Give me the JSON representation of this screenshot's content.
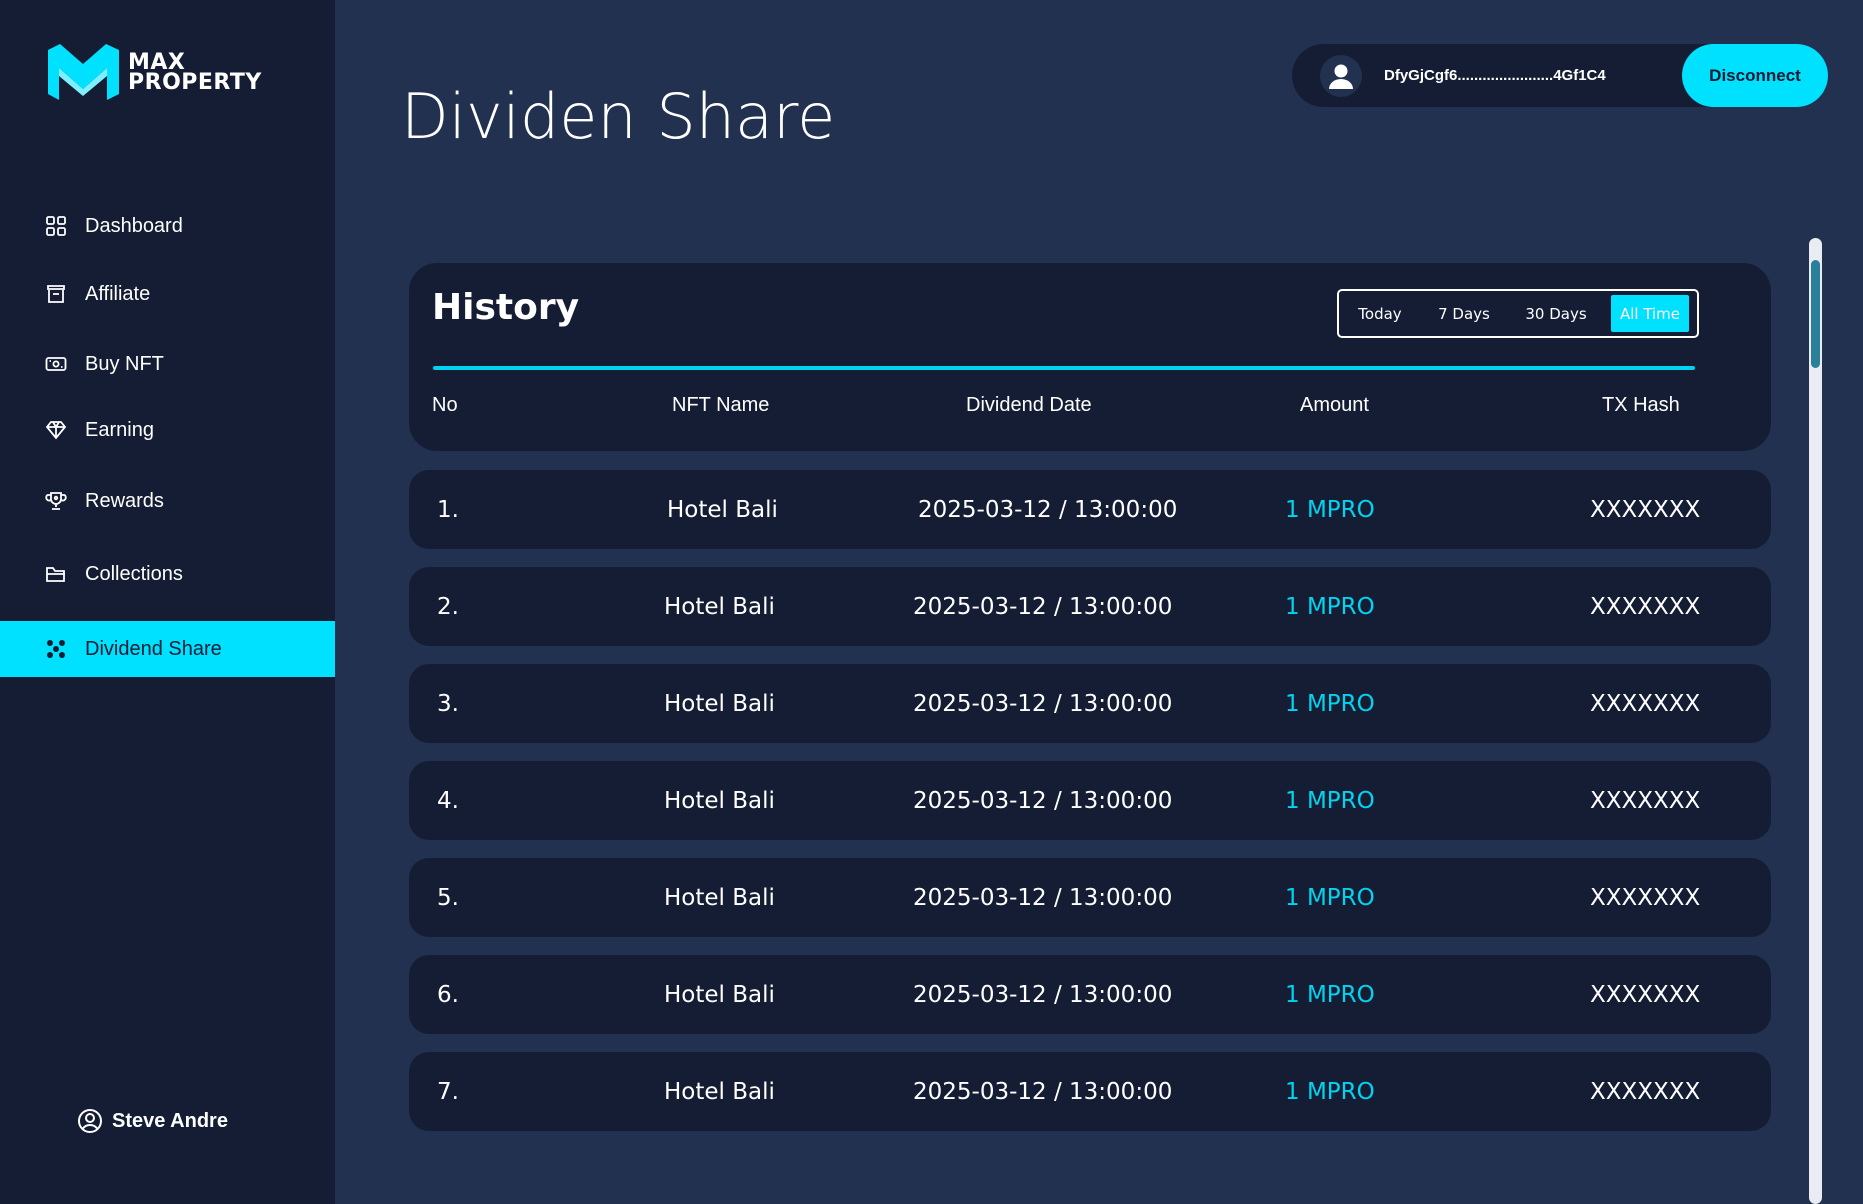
{
  "brand": {
    "line1": "MAX",
    "line2": "PROPERTY",
    "accent": "#00e0ff"
  },
  "sidebar": {
    "items": [
      {
        "label": "Dashboard",
        "icon": "grid-icon"
      },
      {
        "label": "Affiliate",
        "icon": "box-icon"
      },
      {
        "label": "Buy NFT",
        "icon": "cash-icon"
      },
      {
        "label": "Earning",
        "icon": "diamond-icon"
      },
      {
        "label": "Rewards",
        "icon": "trophy-icon"
      },
      {
        "label": "Collections",
        "icon": "folder-icon"
      },
      {
        "label": "Dividend Share",
        "icon": "nodes-icon",
        "active": true
      }
    ],
    "user": "Steve Andre"
  },
  "header": {
    "title": "Dividen Share",
    "wallet_address": "DfyGjCgf6.......................4Gf1C4",
    "disconnect_label": "Disconnect"
  },
  "history": {
    "title": "History",
    "filters": [
      "Today",
      "7 Days",
      "30 Days",
      "All Time"
    ],
    "active_filter": "All Time",
    "columns": [
      "No",
      "NFT Name",
      "Dividend Date",
      "Amount",
      "TX Hash"
    ],
    "rows": [
      {
        "no": "1.",
        "name": "Hotel Bali",
        "date": "2025-03-12 / 13:00:00",
        "amount": "1 MPRO",
        "tx": "XXXXXXX"
      },
      {
        "no": "2.",
        "name": "Hotel Bali",
        "date": "2025-03-12 / 13:00:00",
        "amount": "1 MPRO",
        "tx": "XXXXXXX"
      },
      {
        "no": "3.",
        "name": "Hotel Bali",
        "date": "2025-03-12 / 13:00:00",
        "amount": "1 MPRO",
        "tx": "XXXXXXX"
      },
      {
        "no": "4.",
        "name": "Hotel Bali",
        "date": "2025-03-12 / 13:00:00",
        "amount": "1 MPRO",
        "tx": "XXXXXXX"
      },
      {
        "no": "5.",
        "name": "Hotel Bali",
        "date": "2025-03-12 / 13:00:00",
        "amount": "1 MPRO",
        "tx": "XXXXXXX"
      },
      {
        "no": "6.",
        "name": "Hotel Bali",
        "date": "2025-03-12 / 13:00:00",
        "amount": "1 MPRO",
        "tx": "XXXXXXX"
      },
      {
        "no": "7.",
        "name": "Hotel Bali",
        "date": "2025-03-12 / 13:00:00",
        "amount": "1 MPRO",
        "tx": "XXXXXXX"
      }
    ]
  }
}
